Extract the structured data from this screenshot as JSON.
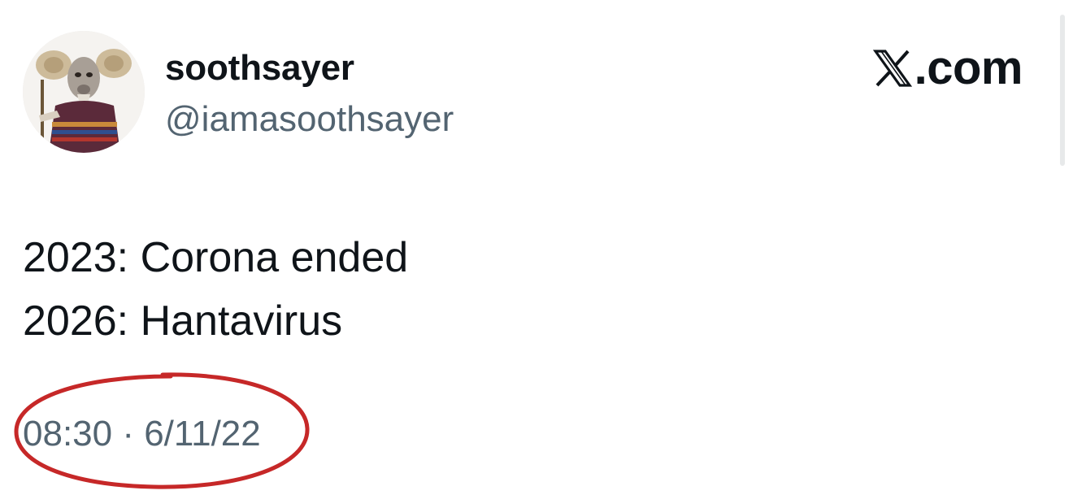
{
  "author": {
    "display_name": "soothsayer",
    "handle": "@iamasoothsayer",
    "avatar_icon": "ram-character-avatar"
  },
  "brand": {
    "logo_icon": "x-logo-icon",
    "text": ".com"
  },
  "tweet": {
    "lines": [
      "2023: Corona ended",
      "2026: Hantavirus"
    ]
  },
  "meta": {
    "timestamp": "08:30 · 6/11/22"
  },
  "annotation": {
    "shape": "hand-drawn-ellipse",
    "color": "#c62828",
    "target": "timestamp"
  },
  "colors": {
    "text_primary": "#0f1419",
    "text_secondary": "#536471",
    "background": "#ffffff"
  }
}
